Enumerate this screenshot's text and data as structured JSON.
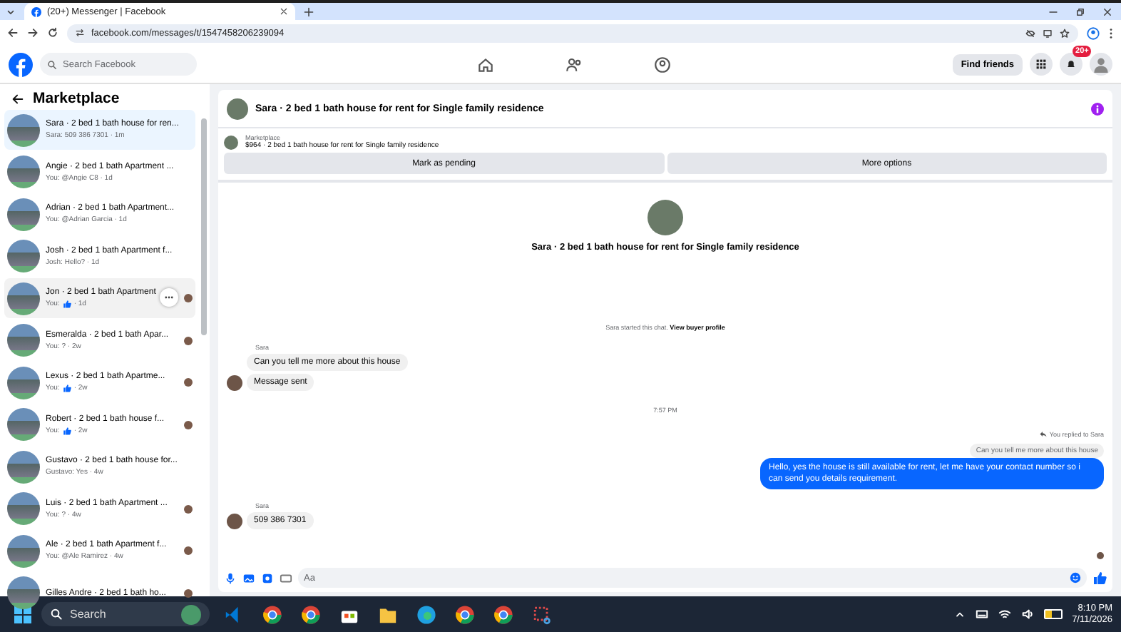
{
  "browser": {
    "tab_title": "(20+) Messenger | Facebook",
    "url": "facebook.com/messages/t/1547458206239094"
  },
  "header": {
    "search": {
      "placeholder": "Search Facebook"
    },
    "find_friends": "Find friends",
    "notifications_badge": "20+"
  },
  "sidebar": {
    "title": "Marketplace",
    "items": [
      {
        "title": "Sara · 2 bed 1 bath house for ren...",
        "preview": "Sara: 509 386 7301 · 1m",
        "thumbs_up": false,
        "selected": true,
        "hovered": false,
        "seen": false
      },
      {
        "title": "Angie · 2 bed 1 bath Apartment ...",
        "preview": "You: @Angie C8 · 1d",
        "thumbs_up": false,
        "selected": false,
        "hovered": false,
        "seen": false
      },
      {
        "title": "Adrian · 2 bed 1 bath Apartment...",
        "preview": "You: @Adrian Garcia · 1d",
        "thumbs_up": false,
        "selected": false,
        "hovered": false,
        "seen": false
      },
      {
        "title": "Josh · 2 bed 1 bath Apartment f...",
        "preview": "Josh: Hello? · 1d",
        "thumbs_up": false,
        "selected": false,
        "hovered": false,
        "seen": false
      },
      {
        "title": "Jon · 2 bed 1 bath Apartment",
        "preview": "You:",
        "suffix": "· 1d",
        "thumbs_up": true,
        "selected": false,
        "hovered": true,
        "seen": true
      },
      {
        "title": "Esmeralda · 2 bed 1 bath Apar...",
        "preview": "You: ? · 2w",
        "thumbs_up": false,
        "selected": false,
        "hovered": false,
        "seen": true
      },
      {
        "title": "Lexus · 2 bed 1 bath Apartme...",
        "preview": "You:",
        "suffix": "· 2w",
        "thumbs_up": true,
        "selected": false,
        "hovered": false,
        "seen": true
      },
      {
        "title": "Robert · 2 bed 1 bath house f...",
        "preview": "You:",
        "suffix": "· 2w",
        "thumbs_up": true,
        "selected": false,
        "hovered": false,
        "seen": true
      },
      {
        "title": "Gustavo · 2 bed 1 bath house for...",
        "preview": "Gustavo: Yes · 4w",
        "thumbs_up": false,
        "selected": false,
        "hovered": false,
        "seen": false
      },
      {
        "title": "Luis · 2 bed 1 bath Apartment ...",
        "preview": "You: ? · 4w",
        "thumbs_up": false,
        "selected": false,
        "hovered": false,
        "seen": true
      },
      {
        "title": "Ale · 2 bed 1 bath Apartment f...",
        "preview": "You: @Ale Ramirez · 4w",
        "thumbs_up": false,
        "selected": false,
        "hovered": false,
        "seen": true
      },
      {
        "title": "Gilles Andre · 2 bed 1 bath ho...",
        "thumbs_up": false,
        "selected": false,
        "hovered": false,
        "seen": true
      }
    ]
  },
  "chat": {
    "title": "Sara · 2 bed 1 bath house for rent for Single family residence",
    "listing": {
      "label": "Marketplace",
      "text": "$964 · 2 bed 1 bath house for rent for Single family residence"
    },
    "buttons": [
      "Mark as pending",
      "More options"
    ],
    "intro_title": "Sara · 2 bed 1 bath house for rent for Single family residence",
    "started": {
      "text": "Sara started this chat.",
      "link": "View buyer profile"
    },
    "messages": [
      {
        "kind": "sender",
        "text": "Sara"
      },
      {
        "kind": "incoming",
        "text": "Can you tell me more about this house",
        "avatar": false
      },
      {
        "kind": "incoming",
        "text": "Message sent",
        "avatar": true
      },
      {
        "kind": "timestamp",
        "text": "7:57 PM"
      },
      {
        "kind": "reply_note",
        "text": "You replied to Sara"
      },
      {
        "kind": "quote",
        "text": "Can you tell me more about this house"
      },
      {
        "kind": "outgoing",
        "text": "Hello, yes the house is still available for rent, let me have your contact number so i can send you details requirement."
      },
      {
        "kind": "sender",
        "text": "Sara"
      },
      {
        "kind": "incoming",
        "text": "509 386 7301",
        "avatar": true
      }
    ],
    "composer": {
      "placeholder": "Aa"
    }
  },
  "taskbar": {
    "search": {
      "placeholder": "Search"
    },
    "time": "8:10 PM",
    "date": "7/11/2026"
  }
}
